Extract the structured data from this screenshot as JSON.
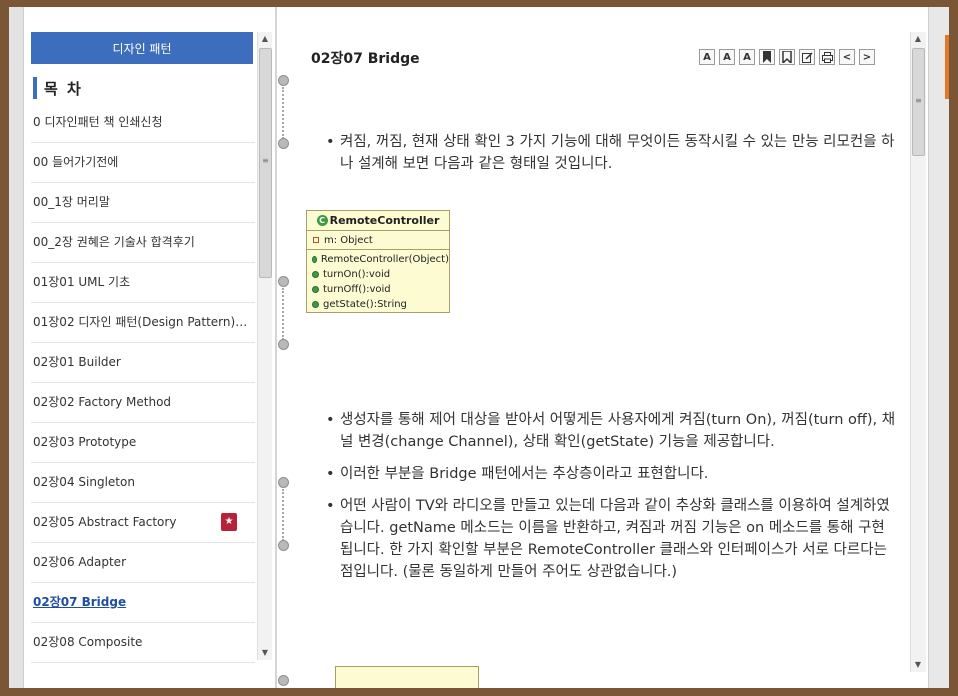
{
  "sidebar": {
    "header": "디자인 패턴",
    "toc_title": "목 차",
    "items": [
      {
        "label": "0 디자인패턴 책 인쇄신청"
      },
      {
        "label": "00 들어가기전에"
      },
      {
        "label": "00_1장 머리말"
      },
      {
        "label": "00_2장 권혜은 기술사 합격후기"
      },
      {
        "label": "01장01 UML 기초"
      },
      {
        "label": "01장02 디자인 패턴(Design Pattern)의..."
      },
      {
        "label": "02장01 Builder"
      },
      {
        "label": "02장02 Factory Method"
      },
      {
        "label": "02장03 Prototype"
      },
      {
        "label": "02장04 Singleton"
      },
      {
        "label": "02장05 Abstract Factory",
        "bookmarked": true
      },
      {
        "label": "02장06 Adapter"
      },
      {
        "label": "02장07 Bridge",
        "active": true
      },
      {
        "label": "02장08 Composite"
      }
    ]
  },
  "content": {
    "title": "02장07 Bridge",
    "toolbar": {
      "font_up": "A",
      "font_down": "A",
      "font_reset": "A",
      "prev": "<",
      "next": ">"
    },
    "paragraphs_top": [
      "켜짐, 꺼짐, 현재 상태 확인 3 가지 기능에 대해 무엇이든 동작시킬 수 있는 만능 리모컨을 하나 설계해 보면 다음과 같은 형태일 것입니다."
    ],
    "uml": {
      "class_name": "RemoteController",
      "attribute": "m: Object",
      "methods": [
        "RemoteController(Object)",
        "turnOn():void",
        "turnOff():void",
        "getState():String"
      ]
    },
    "paragraphs_bottom": [
      "생성자를 통해 제어 대상을 받아서 어떻게든 사용자에게 켜짐(turn On), 꺼짐(turn off), 채널 변경(change Channel), 상태 확인(getState) 기능을 제공합니다.",
      "이러한 부분을 Bridge 패턴에서는 추상층이라고 표현합니다.",
      "어떤 사람이 TV와 라디오를 만들고 있는데 다음과 같이 추상화 클래스를 이용하여 설계하였습니다. getName 메소드는 이름을 반환하고, 켜짐과 꺼짐 기능은 on 메소드를 통해 구현됩니다. 한 가지 확인할 부분은 RemoteController 클래스와 인터페이스가 서로 다르다는 점입니다. (물론 동일하게 만들어 주어도 상관없습니다.)"
    ]
  },
  "colors": {
    "frame": "#7a5637",
    "header_bg": "#3d6dbd",
    "uml_bg": "#fcfbd1",
    "active_link": "#1f4ea3",
    "bookmark": "#b8213a"
  },
  "icons": {
    "toolbar": [
      "font-increase-icon",
      "font-decrease-icon",
      "font-reset-icon",
      "bookmark-icon",
      "bookmark-list-icon",
      "memo-icon",
      "print-icon",
      "prev-page-icon",
      "next-page-icon"
    ],
    "toc_bookmark": "star-bookmark-icon"
  }
}
